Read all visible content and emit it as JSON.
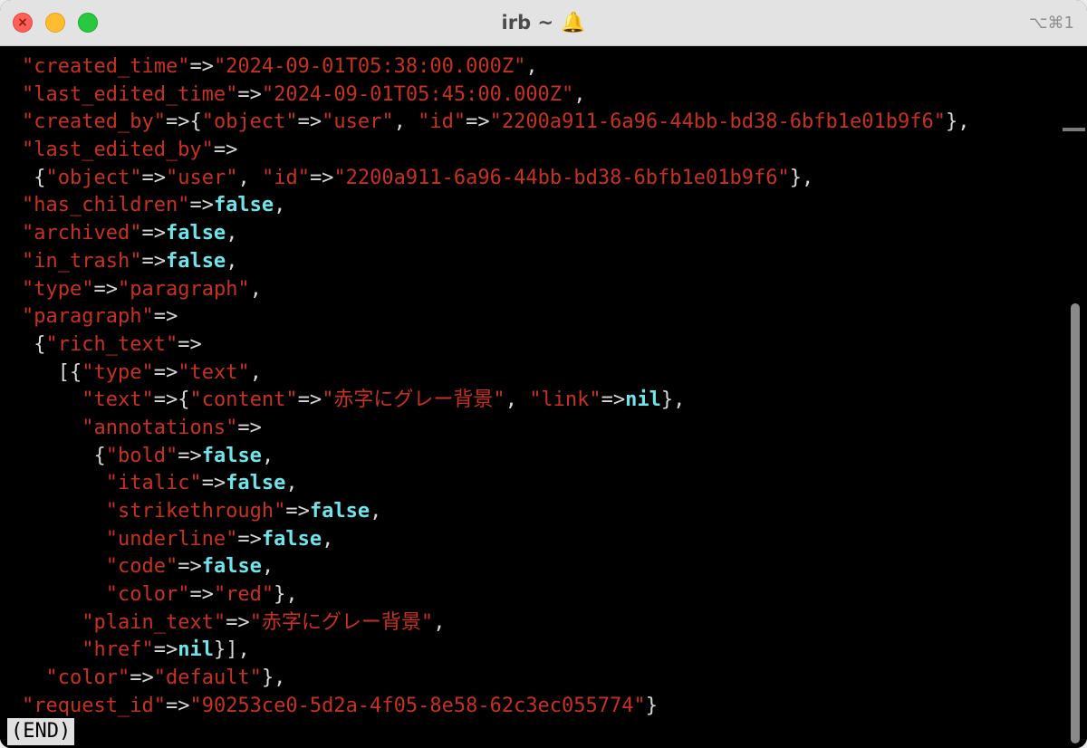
{
  "window": {
    "title": "irb ~",
    "title_icon": "bell-icon",
    "shortcut": "⌥⌘1"
  },
  "colors": {
    "string": "#c8301f",
    "punctuation": "#d8d8d8",
    "keyword": "#6fe4ea",
    "background": "#000000"
  },
  "terminal": {
    "lines": [
      [
        [
          "s",
          "\"created_time\""
        ],
        [
          "p",
          "=>"
        ],
        [
          "s",
          "\"2024-09-01T05:38:00.000Z\""
        ],
        [
          "p",
          ","
        ]
      ],
      [
        [
          "s",
          "\"last_edited_time\""
        ],
        [
          "p",
          "=>"
        ],
        [
          "s",
          "\"2024-09-01T05:45:00.000Z\""
        ],
        [
          "p",
          ","
        ]
      ],
      [
        [
          "s",
          "\"created_by\""
        ],
        [
          "p",
          "=>{"
        ],
        [
          "s",
          "\"object\""
        ],
        [
          "p",
          "=>"
        ],
        [
          "s",
          "\"user\""
        ],
        [
          "p",
          ", "
        ],
        [
          "s",
          "\"id\""
        ],
        [
          "p",
          "=>"
        ],
        [
          "s",
          "\"2200a911-6a96-44bb-bd38-6bfb1e01b9f6\""
        ],
        [
          "p",
          "},"
        ]
      ],
      [
        [
          "s",
          "\"last_edited_by\""
        ],
        [
          "p",
          "=>"
        ]
      ],
      [
        [
          "p",
          " {"
        ],
        [
          "s",
          "\"object\""
        ],
        [
          "p",
          "=>"
        ],
        [
          "s",
          "\"user\""
        ],
        [
          "p",
          ", "
        ],
        [
          "s",
          "\"id\""
        ],
        [
          "p",
          "=>"
        ],
        [
          "s",
          "\"2200a911-6a96-44bb-bd38-6bfb1e01b9f6\""
        ],
        [
          "p",
          "},"
        ]
      ],
      [
        [
          "s",
          "\"has_children\""
        ],
        [
          "p",
          "=>"
        ],
        [
          "k",
          "false"
        ],
        [
          "p",
          ","
        ]
      ],
      [
        [
          "s",
          "\"archived\""
        ],
        [
          "p",
          "=>"
        ],
        [
          "k",
          "false"
        ],
        [
          "p",
          ","
        ]
      ],
      [
        [
          "s",
          "\"in_trash\""
        ],
        [
          "p",
          "=>"
        ],
        [
          "k",
          "false"
        ],
        [
          "p",
          ","
        ]
      ],
      [
        [
          "s",
          "\"type\""
        ],
        [
          "p",
          "=>"
        ],
        [
          "s",
          "\"paragraph\""
        ],
        [
          "p",
          ","
        ]
      ],
      [
        [
          "s",
          "\"paragraph\""
        ],
        [
          "p",
          "=>"
        ]
      ],
      [
        [
          "p",
          " {"
        ],
        [
          "s",
          "\"rich_text\""
        ],
        [
          "p",
          "=>"
        ]
      ],
      [
        [
          "p",
          "   [{"
        ],
        [
          "s",
          "\"type\""
        ],
        [
          "p",
          "=>"
        ],
        [
          "s",
          "\"text\""
        ],
        [
          "p",
          ","
        ]
      ],
      [
        [
          "p",
          "     "
        ],
        [
          "s",
          "\"text\""
        ],
        [
          "p",
          "=>{"
        ],
        [
          "s",
          "\"content\""
        ],
        [
          "p",
          "=>"
        ],
        [
          "s",
          "\"赤字にグレー背景\""
        ],
        [
          "p",
          ", "
        ],
        [
          "s",
          "\"link\""
        ],
        [
          "p",
          "=>"
        ],
        [
          "k",
          "nil"
        ],
        [
          "p",
          "},"
        ]
      ],
      [
        [
          "p",
          "     "
        ],
        [
          "s",
          "\"annotations\""
        ],
        [
          "p",
          "=>"
        ]
      ],
      [
        [
          "p",
          "      {"
        ],
        [
          "s",
          "\"bold\""
        ],
        [
          "p",
          "=>"
        ],
        [
          "k",
          "false"
        ],
        [
          "p",
          ","
        ]
      ],
      [
        [
          "p",
          "       "
        ],
        [
          "s",
          "\"italic\""
        ],
        [
          "p",
          "=>"
        ],
        [
          "k",
          "false"
        ],
        [
          "p",
          ","
        ]
      ],
      [
        [
          "p",
          "       "
        ],
        [
          "s",
          "\"strikethrough\""
        ],
        [
          "p",
          "=>"
        ],
        [
          "k",
          "false"
        ],
        [
          "p",
          ","
        ]
      ],
      [
        [
          "p",
          "       "
        ],
        [
          "s",
          "\"underline\""
        ],
        [
          "p",
          "=>"
        ],
        [
          "k",
          "false"
        ],
        [
          "p",
          ","
        ]
      ],
      [
        [
          "p",
          "       "
        ],
        [
          "s",
          "\"code\""
        ],
        [
          "p",
          "=>"
        ],
        [
          "k",
          "false"
        ],
        [
          "p",
          ","
        ]
      ],
      [
        [
          "p",
          "       "
        ],
        [
          "s",
          "\"color\""
        ],
        [
          "p",
          "=>"
        ],
        [
          "s",
          "\"red\""
        ],
        [
          "p",
          "},"
        ]
      ],
      [
        [
          "p",
          "     "
        ],
        [
          "s",
          "\"plain_text\""
        ],
        [
          "p",
          "=>"
        ],
        [
          "s",
          "\"赤字にグレー背景\""
        ],
        [
          "p",
          ","
        ]
      ],
      [
        [
          "p",
          "     "
        ],
        [
          "s",
          "\"href\""
        ],
        [
          "p",
          "=>"
        ],
        [
          "k",
          "nil"
        ],
        [
          "p",
          "}],"
        ]
      ],
      [
        [
          "p",
          "  "
        ],
        [
          "s",
          "\"color\""
        ],
        [
          "p",
          "=>"
        ],
        [
          "s",
          "\"default\""
        ],
        [
          "p",
          "},"
        ]
      ],
      [
        [
          "s",
          "\"request_id\""
        ],
        [
          "p",
          "=>"
        ],
        [
          "s",
          "\"90253ce0-5d2a-4f05-8e58-62c3ec055774\""
        ],
        [
          "p",
          "}"
        ]
      ]
    ],
    "pager_status": "(END)"
  }
}
